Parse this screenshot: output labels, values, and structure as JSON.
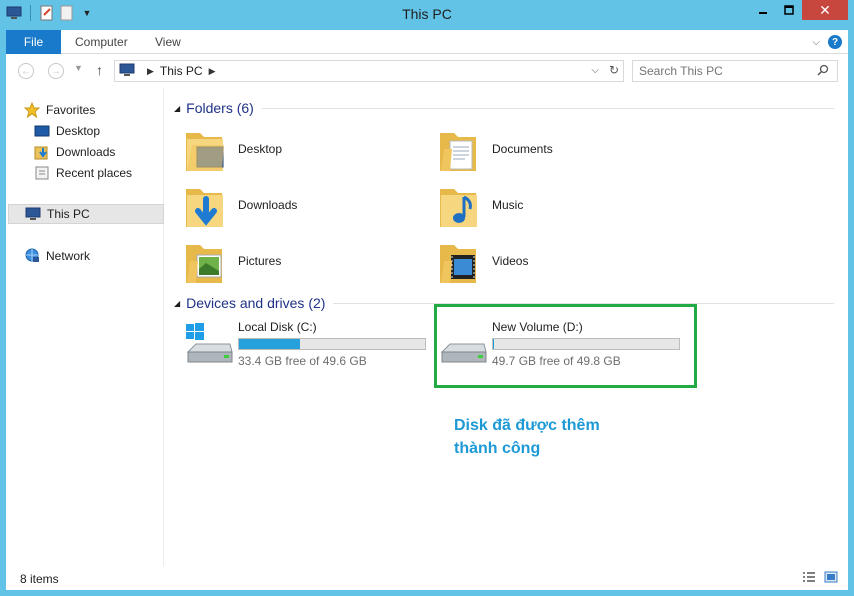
{
  "window": {
    "title": "This PC"
  },
  "ribbon": {
    "tabs": [
      "File",
      "Computer",
      "View"
    ]
  },
  "address": {
    "crumb": "This PC"
  },
  "search": {
    "placeholder": "Search This PC"
  },
  "sidebar": {
    "favorites": "Favorites",
    "items": [
      "Desktop",
      "Downloads",
      "Recent places"
    ],
    "this_pc": "This PC",
    "network": "Network"
  },
  "main": {
    "folders_header": "Folders (6)",
    "folders": [
      {
        "name": "Desktop",
        "icon": "desktop-folder-icon"
      },
      {
        "name": "Documents",
        "icon": "documents-folder-icon"
      },
      {
        "name": "Downloads",
        "icon": "downloads-folder-icon"
      },
      {
        "name": "Music",
        "icon": "music-folder-icon"
      },
      {
        "name": "Pictures",
        "icon": "pictures-folder-icon"
      },
      {
        "name": "Videos",
        "icon": "videos-folder-icon"
      }
    ],
    "drives_header": "Devices and drives (2)",
    "drives": [
      {
        "name": "Local Disk (C:)",
        "free": "33.4 GB free of 49.6 GB",
        "used_fraction": 0.327
      },
      {
        "name": "New Volume (D:)",
        "free": "49.7 GB free of 49.8 GB",
        "used_fraction": 0.002
      }
    ]
  },
  "annotation": {
    "line1": "Disk đã được thêm",
    "line2": "thành công"
  },
  "status": {
    "count": "8 items"
  },
  "colors": {
    "accent": "#1979ca",
    "bar_fill": "#26a0da",
    "highlight": "#22ab45",
    "annotation": "#1d9ad6"
  }
}
